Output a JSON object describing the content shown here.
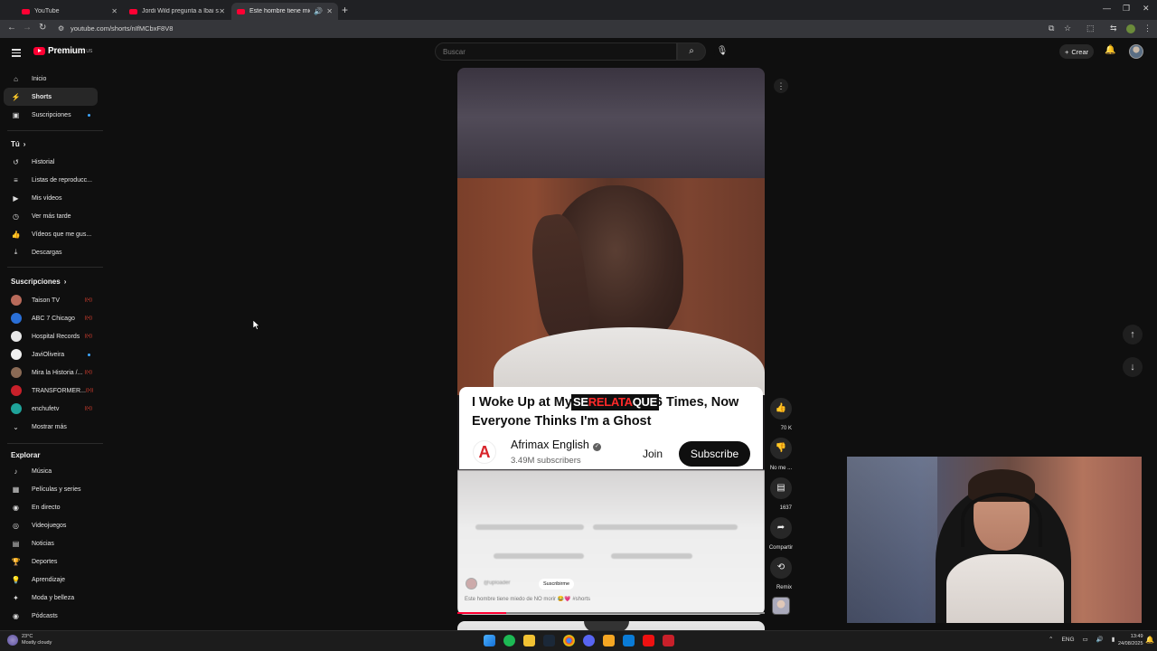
{
  "browser": {
    "tabs": [
      {
        "label": "YouTube",
        "active": false
      },
      {
        "label": "Jordi Wild pregunta a Ibai si es",
        "active": false
      },
      {
        "label": "Este hombre tiene miedo d",
        "active": true
      }
    ],
    "url": "youtube.com/shorts/nIfMCbxF8V8"
  },
  "header": {
    "brand": "Premium",
    "brand_sup": "US",
    "search_placeholder": "Buscar",
    "create_label": "Crear"
  },
  "sidebar": {
    "main": [
      {
        "label": "Inicio",
        "icon": "home-icon"
      },
      {
        "label": "Shorts",
        "icon": "shorts-icon",
        "active": true
      },
      {
        "label": "Suscripciones",
        "icon": "subscriptions-icon"
      }
    ],
    "you_heading": "Tú",
    "you": [
      {
        "label": "Historial",
        "icon": "history-icon"
      },
      {
        "label": "Listas de reproducc...",
        "icon": "playlists-icon"
      },
      {
        "label": "Mis vídeos",
        "icon": "my-videos-icon"
      },
      {
        "label": "Ver más tarde",
        "icon": "watch-later-icon"
      },
      {
        "label": "Vídeos que me gus...",
        "icon": "liked-icon"
      },
      {
        "label": "Descargas",
        "icon": "downloads-icon"
      }
    ],
    "subs_heading": "Suscripciones",
    "subs": [
      {
        "label": "Taison TV",
        "color": "#b86a5a"
      },
      {
        "label": "ABC 7 Chicago",
        "color": "#2a6fd6"
      },
      {
        "label": "Hospital Records",
        "color": "#e8e8e8"
      },
      {
        "label": "JaviOliveira",
        "color": "#f0f0f0"
      },
      {
        "label": "Mira la Historia /...",
        "color": "#8a6a55"
      },
      {
        "label": "TRANSFORMER...",
        "color": "#c8202a"
      },
      {
        "label": "enchufetv",
        "color": "#1fa39a"
      }
    ],
    "show_more": "Mostrar más",
    "explore_heading": "Explorar",
    "explore": [
      {
        "label": "Música",
        "icon": "music-icon"
      },
      {
        "label": "Películas y series",
        "icon": "movies-icon"
      },
      {
        "label": "En directo",
        "icon": "live-icon"
      },
      {
        "label": "Videojuegos",
        "icon": "gaming-icon"
      },
      {
        "label": "Noticias",
        "icon": "news-icon"
      },
      {
        "label": "Deportes",
        "icon": "sports-icon"
      },
      {
        "label": "Aprendizaje",
        "icon": "learning-icon"
      },
      {
        "label": "Moda y belleza",
        "icon": "fashion-icon"
      },
      {
        "label": "Pódcasts",
        "icon": "podcasts-icon"
      }
    ]
  },
  "short": {
    "overlay_text_white": "SE",
    "overlay_text_red": "RELATA",
    "overlay_text_white2": "QUE",
    "card": {
      "title_line1": "I Woke Up at My",
      "title_line1_end": "6 Times, Now",
      "title_line2": "Everyone Thinks I'm a Ghost",
      "channel": "Afrimax English",
      "subscribers": "3.49M subscribers",
      "join_label": "Join",
      "subscribe_label": "Subscribe"
    },
    "uploader_subscribe": "Suscribirme",
    "caption": "Este hombre tiene miedo de NO morir 😂💗 #shorts",
    "progress": 0.16
  },
  "actions": {
    "likes": "70 K",
    "dislike_label": "No me ...",
    "comments": "1637",
    "share_label": "Compartir",
    "remix_label": "Remix"
  },
  "taskbar": {
    "temp": "23°C",
    "weather": "Mostly cloudy",
    "lang": "ENG",
    "time": "13:49",
    "date": "24/08/2025"
  }
}
